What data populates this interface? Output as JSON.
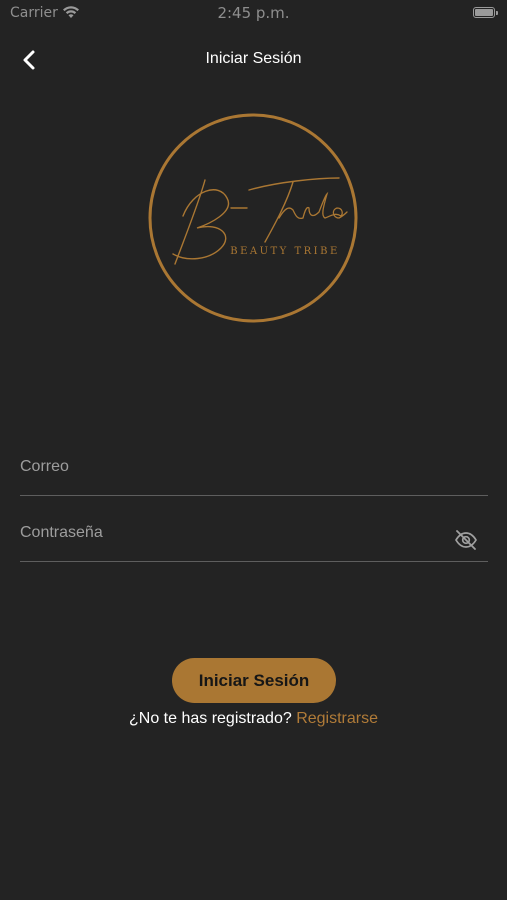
{
  "status_bar": {
    "carrier": "Carrier",
    "time": "2:45 p.m.",
    "wifi_icon": "wifi-icon",
    "battery_icon": "battery-icon"
  },
  "nav": {
    "back_icon": "chevron-left-icon",
    "title": "Iniciar Sesión"
  },
  "logo": {
    "brand": "B-Tribe",
    "tagline": "BEAUTY TRIBE",
    "color": "#aa7733"
  },
  "form": {
    "email_placeholder": "Correo",
    "password_placeholder": "Contraseña",
    "password_toggle_icon": "eye-off-icon",
    "submit_label": "Iniciar Sesión"
  },
  "register": {
    "prompt": "¿No te has registrado?",
    "link_label": "Registrarse"
  },
  "colors": {
    "background": "#232323",
    "accent": "#aa7733",
    "link": "#b07b38"
  }
}
